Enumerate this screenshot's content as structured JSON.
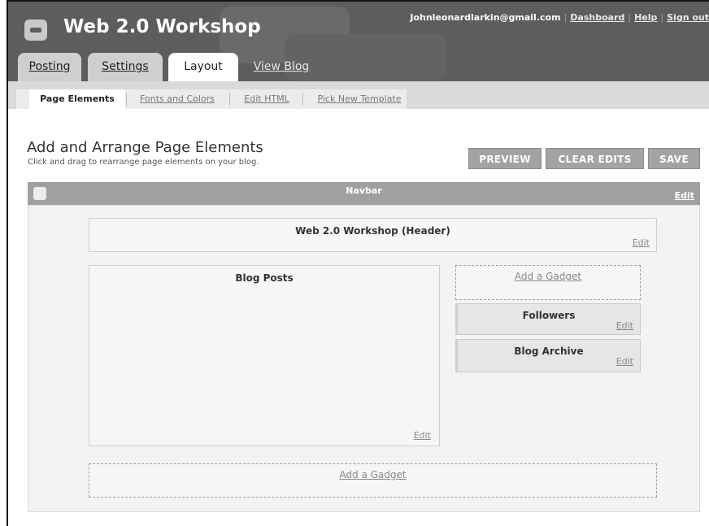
{
  "header": {
    "blog_title": "Web 2.0 Workshop",
    "user_email": "Johnleonardlarkin@gmail.com",
    "links": [
      "Dashboard",
      "Help",
      "Sign out"
    ]
  },
  "tabs": [
    {
      "label": "Posting",
      "state": "inactive"
    },
    {
      "label": "Settings",
      "state": "inactive"
    },
    {
      "label": "Layout",
      "state": "active"
    },
    {
      "label": "View Blog",
      "state": "link"
    }
  ],
  "subtabs": [
    {
      "label": "Page Elements",
      "active": true
    },
    {
      "label": "Fonts and Colors",
      "active": false
    },
    {
      "label": "Edit HTML",
      "active": false
    },
    {
      "label": "Pick New Template",
      "active": false
    }
  ],
  "page": {
    "title": "Add and Arrange Page Elements",
    "subtitle": "Click and drag to rearrange page elements on your blog."
  },
  "buttons": {
    "preview": "PREVIEW",
    "clear_edits": "CLEAR EDITS",
    "save": "SAVE"
  },
  "layout": {
    "navbar": {
      "label": "Navbar",
      "edit": "Edit"
    },
    "header_widget": {
      "title": "Web 2.0 Workshop (Header)",
      "edit": "Edit"
    },
    "blog_posts": {
      "title": "Blog Posts",
      "edit": "Edit"
    },
    "sidebar": {
      "add_gadget": "Add a Gadget",
      "gadgets": [
        {
          "title": "Followers",
          "edit": "Edit"
        },
        {
          "title": "Blog Archive",
          "edit": "Edit"
        }
      ]
    },
    "footer_add_gadget": "Add a Gadget"
  },
  "colors": {
    "header_bg": "#5d5d5d",
    "button_bg": "#a3a3a3",
    "navbar_bg": "#a0a0a0"
  }
}
